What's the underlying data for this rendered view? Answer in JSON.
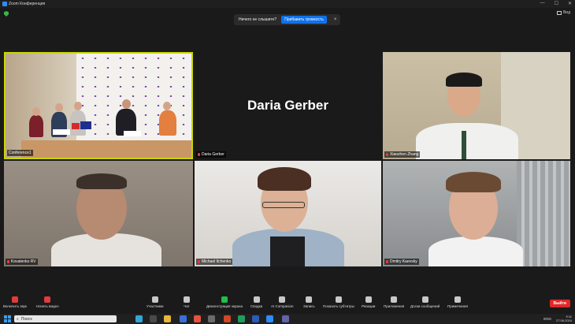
{
  "window": {
    "title": "Zoom Конференция",
    "minimize": "—",
    "maximize": "☐",
    "close": "✕"
  },
  "topbar": {
    "view_label": "Вид"
  },
  "banner": {
    "text": "Ничего не слышите?",
    "button": "Прибавить громкость",
    "close": "×"
  },
  "participants": [
    {
      "name": "Conference1"
    },
    {
      "name": "Daria Gerber",
      "display": "Daria Gerber"
    },
    {
      "name": "Xiaozhen Zhang"
    },
    {
      "name": "Kovalenko RV"
    },
    {
      "name": "Michael Ilchenko"
    },
    {
      "name": "Dmitry Kaevsky"
    }
  ],
  "toolbar": {
    "items": [
      {
        "label": "Включить звук",
        "icon": "microphone-icon"
      },
      {
        "label": "Начать видео",
        "icon": "camera-icon"
      },
      {
        "label": "Участники",
        "icon": "participants-icon",
        "count": "6"
      },
      {
        "label": "Чат",
        "icon": "chat-icon"
      },
      {
        "label": "Демонстрация экрана",
        "icon": "share-screen-icon"
      },
      {
        "label": "Сводка",
        "icon": "summary-icon"
      },
      {
        "label": "AI Companion",
        "icon": "ai-icon"
      },
      {
        "label": "Запись",
        "icon": "record-icon"
      },
      {
        "label": "Показать субтитры",
        "icon": "cc-icon"
      },
      {
        "label": "Реакции",
        "icon": "reactions-icon"
      },
      {
        "label": "Приложения",
        "icon": "apps-icon"
      },
      {
        "label": "Доски сообщений",
        "icon": "whiteboard-icon"
      },
      {
        "label": "Примечания",
        "icon": "notes-icon"
      }
    ],
    "leave": "Выйти",
    "accent": "#0e72ed",
    "leave_color": "#e02828"
  },
  "taskbar": {
    "search_placeholder": "Поиск",
    "lang": "ENG",
    "time": "9:11",
    "date": "27.06.2024"
  }
}
